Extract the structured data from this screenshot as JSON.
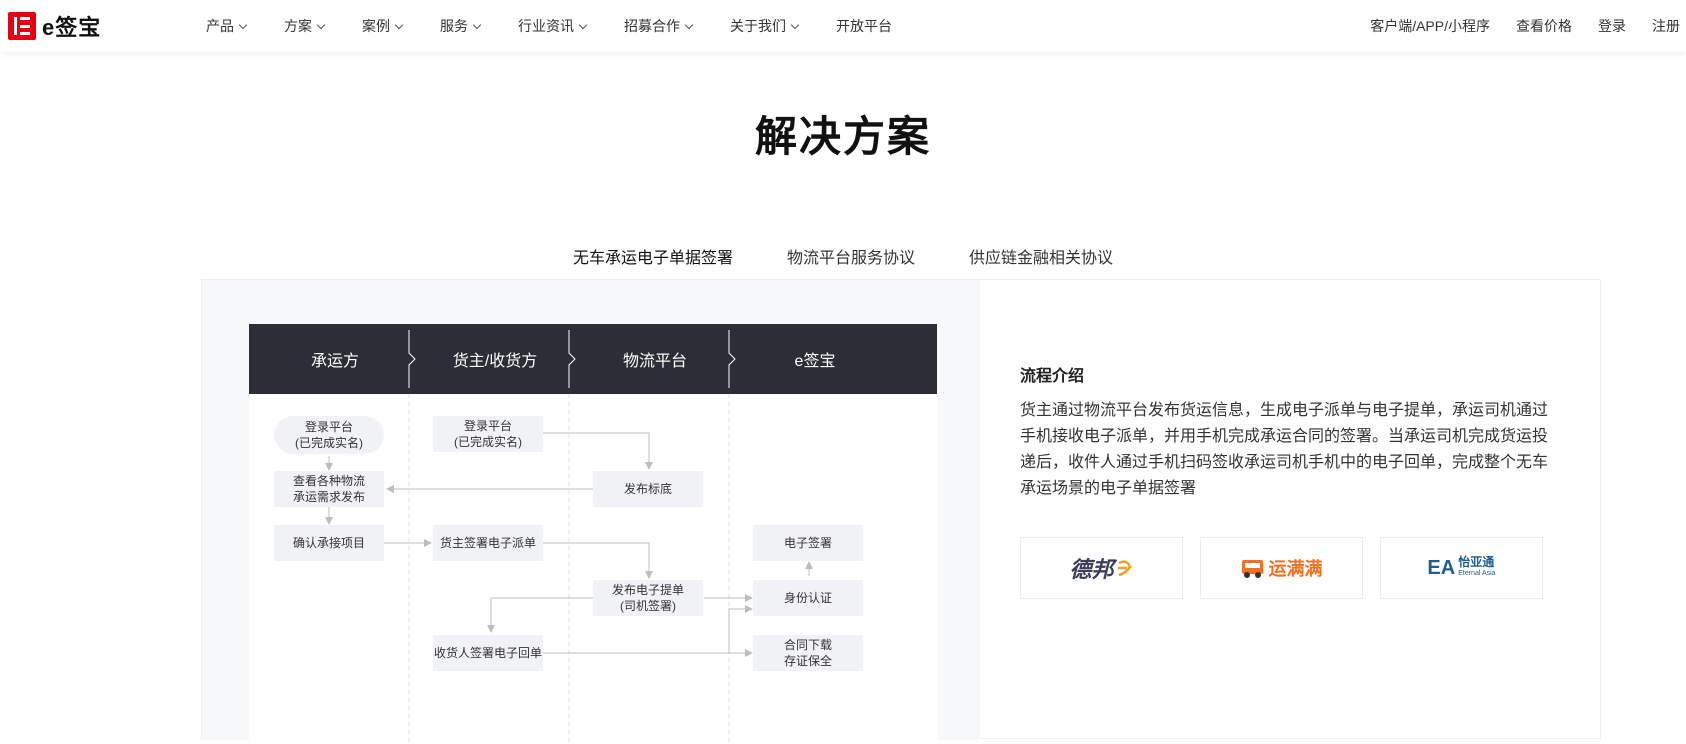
{
  "header": {
    "logo_text": "e签宝",
    "nav": [
      {
        "label": "产品",
        "dropdown": true
      },
      {
        "label": "方案",
        "dropdown": true
      },
      {
        "label": "案例",
        "dropdown": true
      },
      {
        "label": "服务",
        "dropdown": true
      },
      {
        "label": "行业资讯",
        "dropdown": true
      },
      {
        "label": "招募合作",
        "dropdown": true
      },
      {
        "label": "关于我们",
        "dropdown": true
      },
      {
        "label": "开放平台",
        "dropdown": false
      }
    ],
    "right": [
      "客户端/APP/小程序",
      "查看价格",
      "登录",
      "注册"
    ]
  },
  "page_title": "解决方案",
  "tabs": [
    {
      "label": "无车承运电子单据签署",
      "active": true
    },
    {
      "label": "物流平台服务协议",
      "active": false
    },
    {
      "label": "供应链金融相关协议",
      "active": false
    }
  ],
  "flow": {
    "lanes": [
      "承运方",
      "货主/收货方",
      "物流平台",
      "e签宝"
    ],
    "nodes": {
      "carrier_login": "登录平台\n(已完成实名)",
      "carrier_view": "查看各种物流\n承运需求发布",
      "carrier_confirm": "确认承接项目",
      "owner_login": "登录平台\n(已完成实名)",
      "owner_sign": "货主签署电子派单",
      "receiver_sign": "收货人签署电子回单",
      "platform_publish": "发布标底",
      "platform_bill": "发布电子提单\n(司机签署)",
      "esign_sign": "电子签署",
      "esign_auth": "身份认证",
      "esign_download": "合同下载\n存证保全"
    }
  },
  "intro": {
    "title": "流程介绍",
    "text": "货主通过物流平台发布货运信息，生成电子派单与电子提单，承运司机通过手机接收电子派单，并用手机完成承运合同的签署。当承运司机完成货运投递后，收件人通过手机扫码签收承运司机手机中的电子回单，完成整个无车承运场景的电子单据签署"
  },
  "partners": [
    {
      "name": "德邦",
      "logo_text": "德邦"
    },
    {
      "name": "运满满",
      "logo_text": "运满满"
    },
    {
      "name": "怡亚通",
      "logo_text": "怡亚通",
      "sub": "Eternal Asia"
    }
  ],
  "colors": {
    "brand": "#e60012",
    "flow_header": "#2b2e36",
    "node_bg": "#f1f2f6",
    "line": "#bbbbbb"
  }
}
